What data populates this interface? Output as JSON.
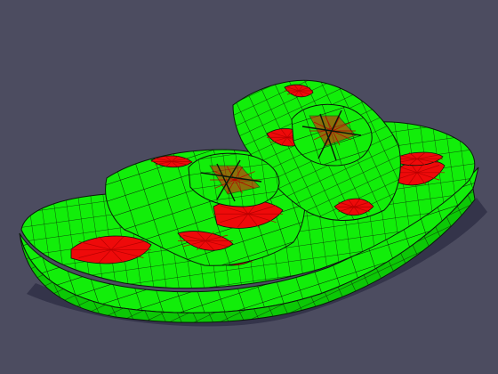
{
  "viewport": {
    "background": "#4c4c60",
    "model": "sandal-mesh",
    "colors": {
      "quad_faces": "#12ee0a",
      "quad_faces_shade": "#0cc806",
      "tri_faces": "#ee0a0a",
      "tri_faces_shade": "#b80000",
      "edges": "#0a1a0a",
      "shadow": "#34344a"
    }
  }
}
